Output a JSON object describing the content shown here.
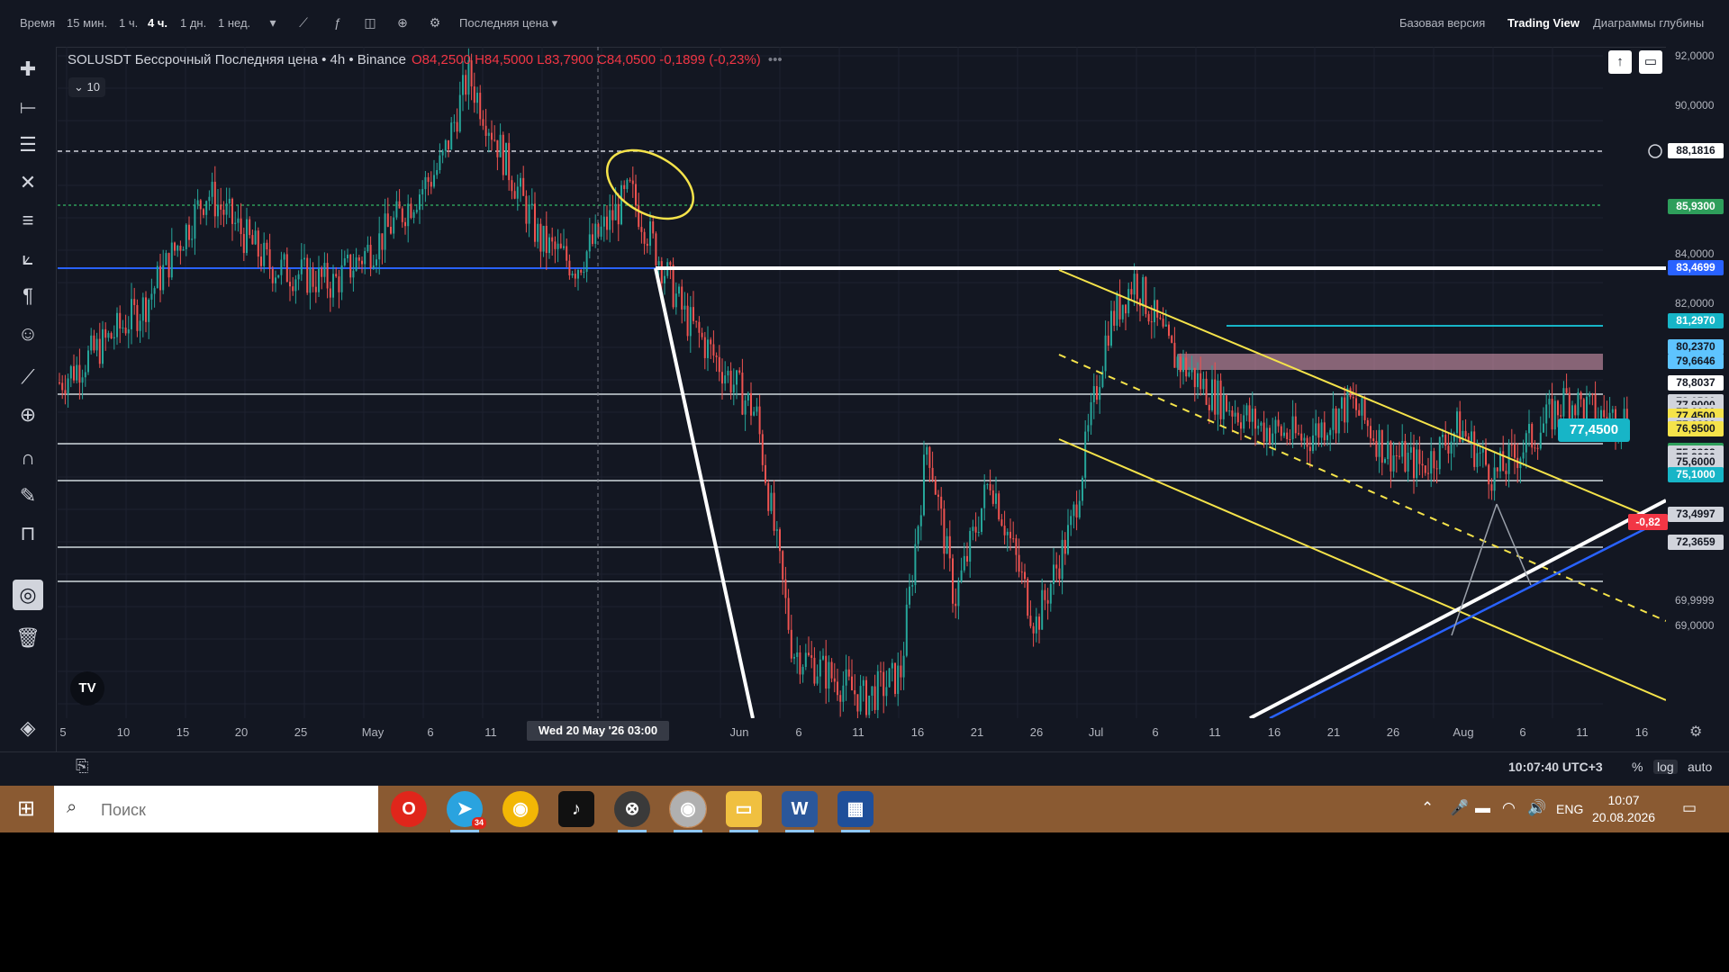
{
  "topbar": {
    "items": [
      "Время",
      "15 мин.",
      "1 ч.",
      "4 ч.",
      "1 дн.",
      "1 нед."
    ],
    "active": "4 ч.",
    "price_type": "Последняя цена",
    "right": [
      "Базовая версия",
      "Trading View",
      "Диаграммы глубины"
    ],
    "right_active": "Trading View"
  },
  "legend": {
    "symbol": "SOLUSDT Бессрочный Последняя цена • 4h • Binance",
    "ohlc": "О84,2500 Н84,5000 L83,7900 C84,0500 -0,1899 (-0,23%)",
    "indicator_count": "10"
  },
  "price_scale": {
    "labels": [
      {
        "text": "92,0000",
        "price": 92.0
      },
      {
        "text": "90,0000",
        "price": 90.0
      },
      {
        "text": "84,0000",
        "price": 84.0
      },
      {
        "text": "82,0000",
        "price": 82.0
      },
      {
        "text": "69,9999",
        "price": 70.0
      },
      {
        "text": "69,0000",
        "price": 69.0
      }
    ],
    "badges": [
      {
        "text": "88,1816",
        "price": 88.18,
        "bg": "#ffffff",
        "fg": "#131722"
      },
      {
        "text": "85,9300",
        "price": 85.93,
        "bg": "#2e9e5b",
        "fg": "#ffffff"
      },
      {
        "text": "83,4699",
        "price": 83.47,
        "bg": "#2962ff",
        "fg": "#ffffff"
      },
      {
        "text": "81,2970",
        "price": 81.3,
        "bg": "#17b5c7",
        "fg": "#ffffff"
      },
      {
        "text": "80,2370",
        "price": 80.24,
        "bg": "#5ec4ff",
        "fg": "#131722"
      },
      {
        "text": "79,6646",
        "price": 79.66,
        "bg": "#5ec4ff",
        "fg": "#131722"
      },
      {
        "text": "78,8037",
        "price": 78.8,
        "bg": "#ffffff",
        "fg": "#131722"
      },
      {
        "text": "78,0500",
        "price": 78.05,
        "bg": "#d1d4dc",
        "fg": "#131722"
      },
      {
        "text": "77,9000",
        "price": 77.9,
        "bg": "#d1d4dc",
        "fg": "#131722"
      },
      {
        "text": "77,6000",
        "price": 77.6,
        "bg": "#d1d4dc",
        "fg": "#131722"
      },
      {
        "text": "77,4500",
        "price": 77.45,
        "bg": "#f5e34a",
        "fg": "#131722"
      },
      {
        "text": "77,0880",
        "price": 77.09,
        "bg": "#d1d4dc",
        "fg": "#131722"
      },
      {
        "text": "76,9500",
        "price": 76.95,
        "bg": "#f5e34a",
        "fg": "#131722"
      },
      {
        "text": "76,0600",
        "price": 76.06,
        "bg": "#2e9e5b",
        "fg": "#ffffff"
      },
      {
        "text": "75,9808",
        "price": 75.98,
        "bg": "#d1d4dc",
        "fg": "#131722"
      },
      {
        "text": "75,8000",
        "price": 75.8,
        "bg": "#d1d4dc",
        "fg": "#131722"
      },
      {
        "text": "75,6000",
        "price": 75.6,
        "bg": "#d1d4dc",
        "fg": "#131722"
      },
      {
        "text": "75,1000",
        "price": 75.1,
        "bg": "#17b5c7",
        "fg": "#ffffff"
      },
      {
        "text": "73,4997",
        "price": 73.5,
        "bg": "#d1d4dc",
        "fg": "#131722"
      },
      {
        "text": "72,3659",
        "price": 72.37,
        "bg": "#d1d4dc",
        "fg": "#131722"
      }
    ],
    "current": {
      "text": "-0,82",
      "bg": "#f23645"
    },
    "floating": {
      "text": "77,4500",
      "bg": "#17b5c7"
    }
  },
  "time_axis": {
    "ticks": [
      "5",
      "10",
      "15",
      "20",
      "25",
      "May",
      "6",
      "11",
      "6",
      "Jun",
      "6",
      "11",
      "16",
      "21",
      "26",
      "Jul",
      "6",
      "11",
      "16",
      "21",
      "26",
      "Aug",
      "6",
      "11",
      "16"
    ],
    "crosshair_label": "Wed 20 May '26   03:00"
  },
  "bottombar": {
    "clock": "10:07:40 UTC+3",
    "percent": "%",
    "log": "log",
    "auto": "auto"
  },
  "taskbar": {
    "search_placeholder": "Поиск",
    "lang": "ENG",
    "time": "10:07",
    "date": "20.08.2026",
    "telegram_badge": "34"
  },
  "colors": {
    "background": "#131722",
    "up": "#26a69a",
    "down": "#ef5350",
    "yellow": "#f5e34a",
    "blue": "#2962ff",
    "cyan": "#17b5c7"
  }
}
